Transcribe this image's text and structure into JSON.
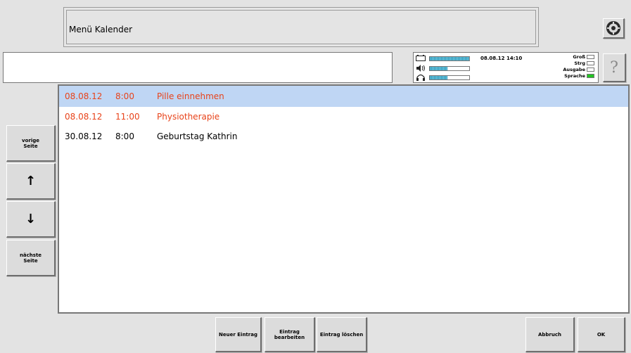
{
  "header": {
    "title": "Menü Kalender"
  },
  "input": {
    "value": ""
  },
  "status": {
    "meters": [
      {
        "icon": "battery-icon",
        "level": 1.0
      },
      {
        "icon": "speaker-icon",
        "level": 0.45
      },
      {
        "icon": "headphones-icon",
        "level": 0.45
      }
    ],
    "datetime": "08.08.12 14:10",
    "flags": [
      {
        "label": "Groß",
        "active": false
      },
      {
        "label": "Strg",
        "active": false
      },
      {
        "label": "Ausgabe",
        "active": false
      },
      {
        "label": "Sprache",
        "active": true
      }
    ],
    "active_color": "#22c322"
  },
  "entries": [
    {
      "date": "08.08.12",
      "time": "8:00",
      "title": "Pille einnehmen",
      "highlight": true,
      "selected": true
    },
    {
      "date": "08.08.12",
      "time": "11:00",
      "title": "Physiotherapie",
      "highlight": true,
      "selected": false
    },
    {
      "date": "30.08.12",
      "time": "8:00",
      "title": "Geburtstag Kathrin",
      "highlight": false,
      "selected": false
    }
  ],
  "colors": {
    "alert": "#e8431a",
    "selection": "#bfd6f4"
  },
  "sidebar": {
    "prev_page": "vorige\nSeite",
    "up": "↑",
    "down": "↓",
    "next_page": "nächste\nSeite"
  },
  "footer": {
    "new_entry": "Neuer Eintrag",
    "edit_entry": "Eintrag\nbearbeiten",
    "delete_entry": "Eintrag löschen",
    "cancel": "Abbruch",
    "ok": "OK"
  },
  "icons": {
    "settings": "gear-icon",
    "help": "?"
  }
}
